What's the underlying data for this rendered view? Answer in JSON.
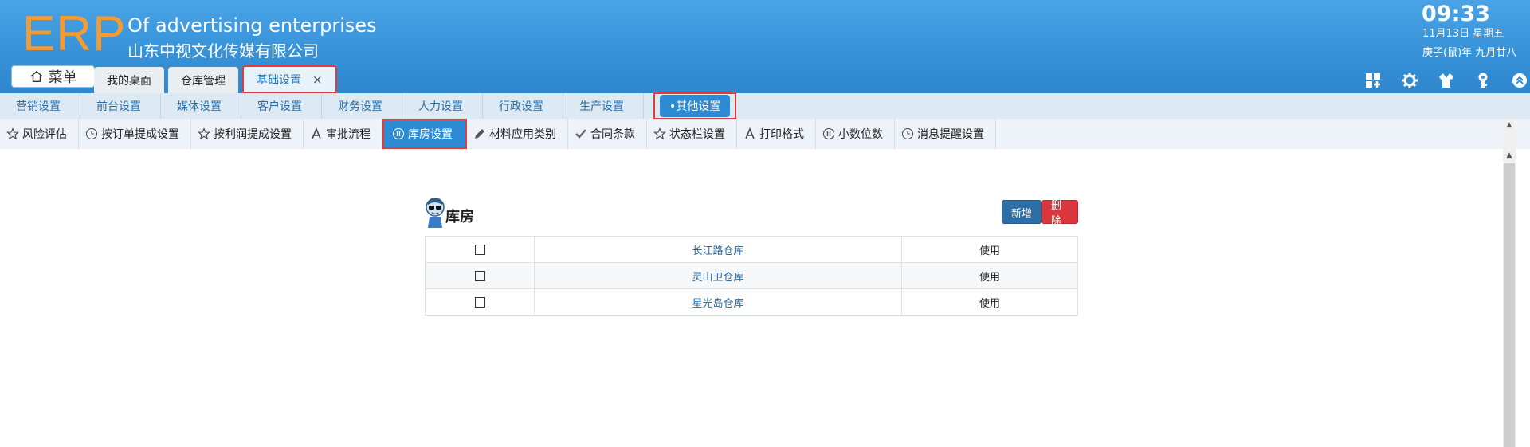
{
  "header": {
    "logo": "ERP",
    "company_en": "Of advertising enterprises",
    "company_cn": "山东中视文化传媒有限公司",
    "menu_label": "菜单",
    "tabs": [
      {
        "label": "我的桌面"
      },
      {
        "label": "仓库管理"
      },
      {
        "label": "基础设置",
        "close": "×"
      }
    ],
    "clock": "09:33",
    "date": "11月13日 星期五",
    "lunar": "庚子(鼠)年 九月廿八",
    "tools": [
      "apps-icon",
      "gear-icon",
      "shirt-icon",
      "key-icon",
      "collapse-up-icon"
    ]
  },
  "nav2": {
    "items": [
      "营销设置",
      "前台设置",
      "媒体设置",
      "客户设置",
      "财务设置",
      "人力设置",
      "行政设置",
      "生产设置"
    ],
    "active": "•其他设置"
  },
  "nav3": {
    "items": [
      {
        "label": "风险评估",
        "icon": "star-icon"
      },
      {
        "label": "按订单提成设置",
        "icon": "clock-icon"
      },
      {
        "label": "按利润提成设置",
        "icon": "star-icon"
      },
      {
        "label": "审批流程",
        "icon": "font-icon"
      },
      {
        "label": "库房设置",
        "icon": "pause-circle-icon"
      },
      {
        "label": "材料应用类别",
        "icon": "pencil-icon"
      },
      {
        "label": "合同条款",
        "icon": "check-icon"
      },
      {
        "label": "状态栏设置",
        "icon": "star-icon"
      },
      {
        "label": "打印格式",
        "icon": "font-icon"
      },
      {
        "label": "小数位数",
        "icon": "pause-circle-icon"
      },
      {
        "label": "消息提醒设置",
        "icon": "clock-icon"
      }
    ]
  },
  "panel": {
    "title": "库房",
    "add_label": "新增",
    "delete_label": "删除",
    "rows": [
      {
        "name": "长江路仓库",
        "status": "使用"
      },
      {
        "name": "灵山卫仓库",
        "status": "使用"
      },
      {
        "name": "星光岛仓库",
        "status": "使用"
      }
    ]
  },
  "colors": {
    "header_blue": "#3691d8",
    "logo_orange": "#f39b34",
    "active_blue": "#2d8bd4",
    "highlight_red": "#e23b3b",
    "add_button": "#2d6ea6",
    "delete_button": "#d9363e"
  }
}
